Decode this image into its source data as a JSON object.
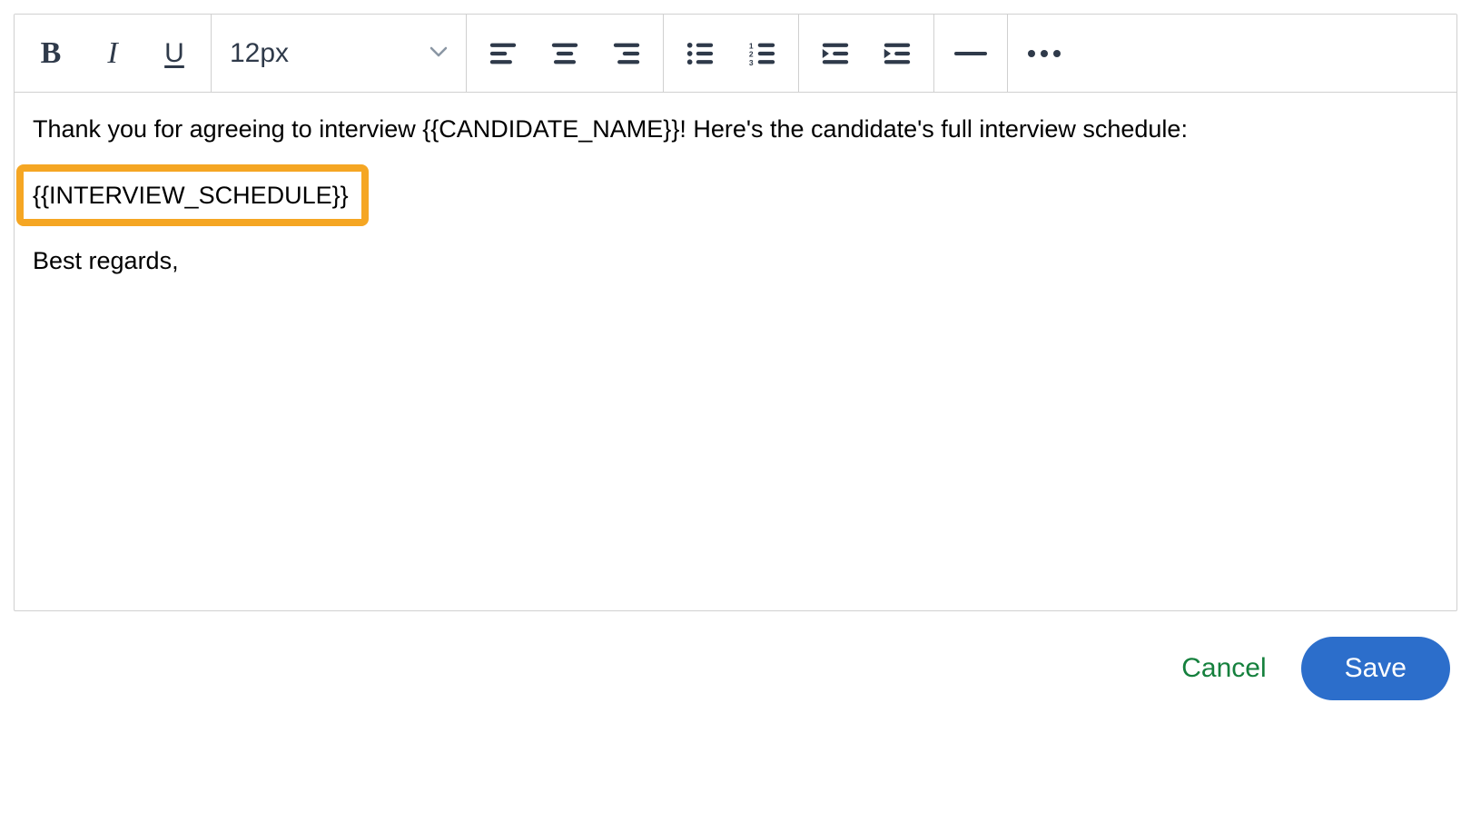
{
  "toolbar": {
    "bold_glyph": "B",
    "italic_glyph": "I",
    "underline_glyph": "U",
    "font_size_label": "12px"
  },
  "content": {
    "line1": "Thank you for agreeing to interview {{CANDIDATE_NAME}}! Here's the candidate's full interview schedule:",
    "line2": "{{INTERVIEW_SCHEDULE}}",
    "line3": "Best regards,"
  },
  "actions": {
    "cancel_label": "Cancel",
    "save_label": "Save"
  }
}
